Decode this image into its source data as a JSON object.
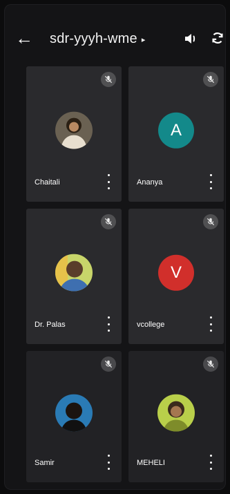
{
  "header": {
    "back_icon": "arrow-left-icon",
    "meeting_code": "sdr-yyyh-wme",
    "caret_icon": "caret-right-icon",
    "speaker_icon": "speaker-icon",
    "switch_camera_icon": "switch-camera-icon"
  },
  "participants": [
    {
      "name": "Chaitali",
      "avatar": "photo",
      "muted": true
    },
    {
      "name": "Ananya",
      "avatar": "initial",
      "initial": "A",
      "color": "#13898a",
      "muted": true
    },
    {
      "name": "Dr. Palas",
      "avatar": "photo",
      "muted": true
    },
    {
      "name": "vcollege",
      "avatar": "initial",
      "initial": "V",
      "color": "#d12f2b",
      "muted": true
    },
    {
      "name": "Samir",
      "avatar": "photo",
      "muted": true
    },
    {
      "name": "MEHELI",
      "avatar": "photo",
      "muted": true
    }
  ],
  "icons": {
    "mute": "mic-off-icon",
    "more": "more-vertical-icon"
  }
}
